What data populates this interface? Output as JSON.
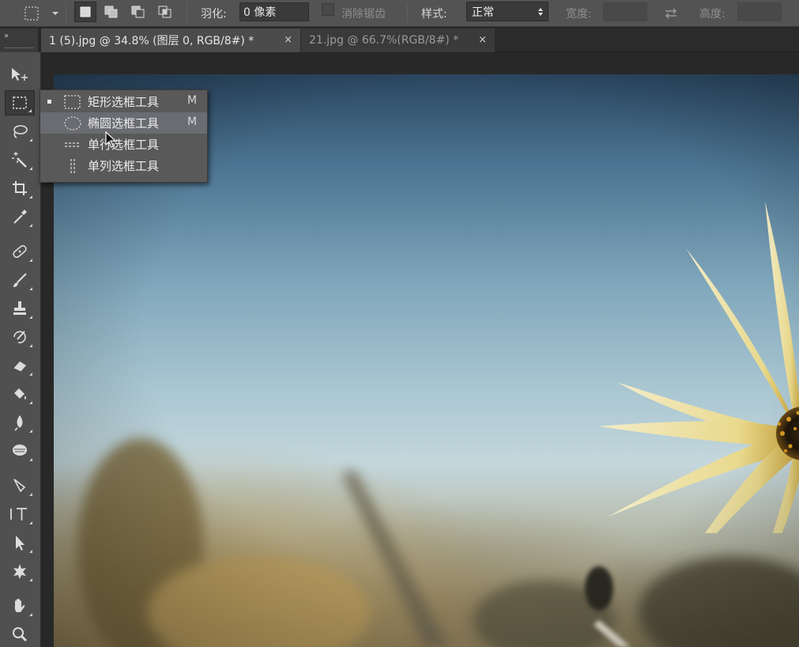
{
  "options_bar": {
    "feather_label": "羽化:",
    "feather_value": "0 像素",
    "antialias_label": "消除锯齿",
    "style_label": "样式:",
    "style_value": "正常",
    "width_label": "宽度:",
    "height_label": "高度:",
    "swap_icon": "swap-icon"
  },
  "tabs": [
    {
      "label": "1 (5).jpg @ 34.8% (图层 0, RGB/8#) *",
      "close": "×",
      "active": true
    },
    {
      "label": "21.jpg @ 66.7%(RGB/8#) *",
      "close": "×",
      "active": false
    }
  ],
  "collapse_label": "»",
  "flyout": {
    "items": [
      {
        "label": "矩形选框工具",
        "shortcut": "M",
        "icon": "rect-marquee-icon",
        "current": true
      },
      {
        "label": "椭圆选框工具",
        "shortcut": "M",
        "icon": "ellipse-marquee-icon",
        "hover": true
      },
      {
        "label": "单行选框工具",
        "shortcut": "",
        "icon": "single-row-marquee-icon"
      },
      {
        "label": "单列选框工具",
        "shortcut": "",
        "icon": "single-column-marquee-icon"
      }
    ]
  },
  "tools": [
    "move-tool-icon",
    "rect-marquee-tool-icon",
    "lasso-tool-icon",
    "magic-wand-tool-icon",
    "crop-tool-icon",
    "eyedropper-tool-icon",
    "healing-brush-tool-icon",
    "brush-tool-icon",
    "clone-stamp-tool-icon",
    "history-brush-tool-icon",
    "eraser-tool-icon",
    "paint-bucket-tool-icon",
    "blur-tool-icon",
    "dodge-tool-icon",
    "pen-tool-icon",
    "type-tool-icon",
    "path-selection-tool-icon",
    "custom-shape-tool-icon",
    "hand-tool-icon",
    "zoom-tool-icon"
  ],
  "colors": {
    "panel": "#535353",
    "toolbar": "#505050",
    "menu_hover": "#6a6c72",
    "canvas_bg": "#282828"
  }
}
